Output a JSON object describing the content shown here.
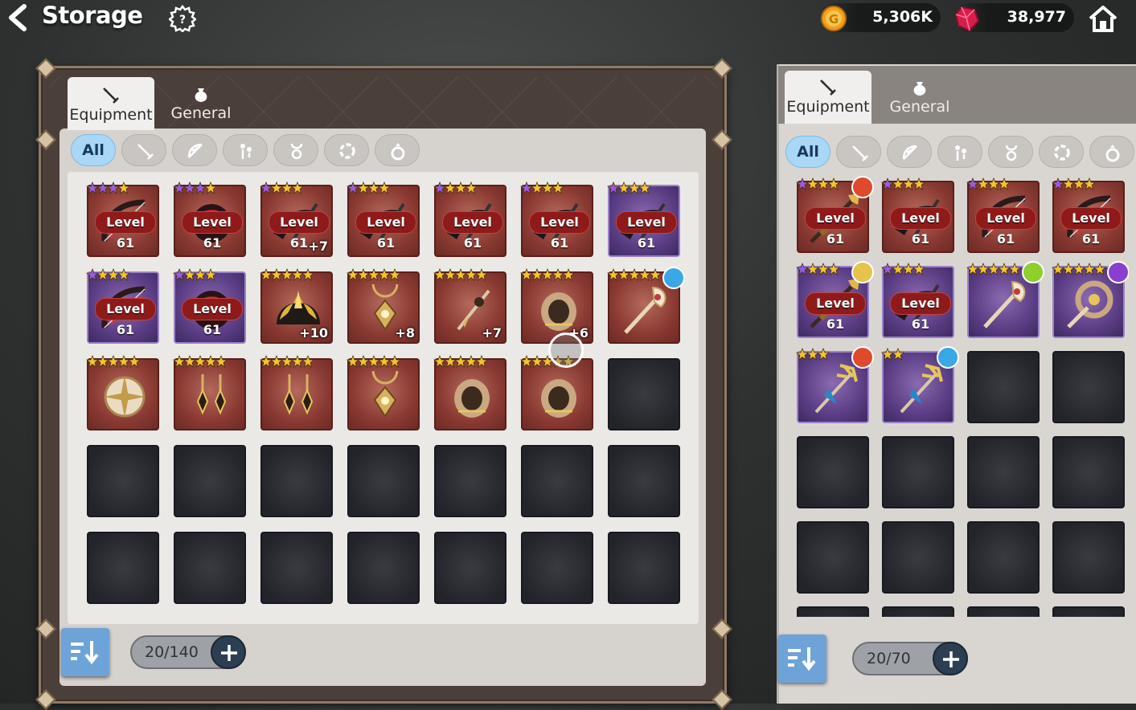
{
  "header": {
    "title": "Storage"
  },
  "currency": {
    "gold": "5,306K",
    "gems": "38,977"
  },
  "left": {
    "tabs": [
      {
        "label": "Equipment"
      },
      {
        "label": "General"
      }
    ],
    "filter_all": "All",
    "count": "20/140",
    "slots": [
      {
        "frame": "red",
        "art": "bow",
        "stars": 4,
        "starColor": "purple",
        "level": "Level 61"
      },
      {
        "frame": "red",
        "art": "orb",
        "stars": 4,
        "starColor": "purple",
        "level": "Level 61"
      },
      {
        "frame": "red",
        "art": "scythe",
        "stars": 4,
        "starColor": "mixed",
        "level": "Level 61",
        "plus": "+7"
      },
      {
        "frame": "red",
        "art": "scythe",
        "stars": 4,
        "starColor": "mixed",
        "level": "Level 61"
      },
      {
        "frame": "red",
        "art": "scythe",
        "stars": 4,
        "starColor": "mixed",
        "level": "Level 61"
      },
      {
        "frame": "red",
        "art": "scythe",
        "stars": 4,
        "starColor": "mixed",
        "level": "Level 61"
      },
      {
        "frame": "purple",
        "art": "scythe",
        "stars": 4,
        "starColor": "mixed",
        "level": "Level 61"
      },
      {
        "frame": "purple",
        "art": "bow",
        "stars": 4,
        "starColor": "mixed",
        "level": "Level 61"
      },
      {
        "frame": "purple",
        "art": "orb",
        "stars": 4,
        "starColor": "mixed",
        "level": "Level 61"
      },
      {
        "frame": "red",
        "art": "helm",
        "stars": 5,
        "starColor": "gold",
        "plus": "+10"
      },
      {
        "frame": "red",
        "art": "amulet",
        "stars": 5,
        "starColor": "gold",
        "plus": "+8"
      },
      {
        "frame": "red",
        "art": "earring",
        "stars": 5,
        "starColor": "gold",
        "plus": "+7"
      },
      {
        "frame": "red",
        "art": "bracer",
        "stars": 5,
        "starColor": "gold",
        "plus": "+6"
      },
      {
        "frame": "red",
        "art": "staff",
        "stars": 5,
        "starColor": "gold",
        "elem": "water"
      },
      {
        "frame": "red",
        "art": "compass",
        "stars": 5,
        "starColor": "gold"
      },
      {
        "frame": "red",
        "art": "earrings",
        "stars": 5,
        "starColor": "gold"
      },
      {
        "frame": "red",
        "art": "earrings",
        "stars": 5,
        "starColor": "gold"
      },
      {
        "frame": "red",
        "art": "amulet",
        "stars": 5,
        "starColor": "gold"
      },
      {
        "frame": "red",
        "art": "bracer",
        "stars": 5,
        "starColor": "gold"
      },
      {
        "frame": "red",
        "art": "bracer",
        "stars": 5,
        "starColor": "gold"
      },
      {
        "frame": "empty"
      },
      {
        "frame": "empty"
      },
      {
        "frame": "empty"
      },
      {
        "frame": "empty"
      },
      {
        "frame": "empty"
      },
      {
        "frame": "empty"
      },
      {
        "frame": "empty"
      },
      {
        "frame": "empty"
      },
      {
        "frame": "empty"
      },
      {
        "frame": "empty"
      },
      {
        "frame": "empty"
      },
      {
        "frame": "empty"
      },
      {
        "frame": "empty"
      },
      {
        "frame": "empty"
      },
      {
        "frame": "empty"
      }
    ]
  },
  "right": {
    "tabs": [
      {
        "label": "Equipment"
      },
      {
        "label": "General"
      }
    ],
    "filter_all": "All",
    "count": "20/70",
    "slots": [
      {
        "frame": "red",
        "art": "spear",
        "stars": 4,
        "starColor": "mixed",
        "level": "Level 61",
        "elem": "fire"
      },
      {
        "frame": "red",
        "art": "scythe",
        "stars": 4,
        "starColor": "mixed",
        "level": "Level 61"
      },
      {
        "frame": "red",
        "art": "bow",
        "stars": 4,
        "starColor": "mixed",
        "level": "Level 61"
      },
      {
        "frame": "red",
        "art": "bow",
        "stars": 4,
        "starColor": "mixed",
        "level": "Level 61"
      },
      {
        "frame": "purple",
        "art": "spear",
        "stars": 4,
        "starColor": "mixed",
        "level": "Level 61",
        "elem": "light"
      },
      {
        "frame": "purple",
        "art": "scythe",
        "stars": 4,
        "starColor": "mixed",
        "level": "Level 61"
      },
      {
        "frame": "purple",
        "art": "staff",
        "stars": 5,
        "starColor": "gold",
        "elem": "earth"
      },
      {
        "frame": "purple",
        "art": "wheel",
        "stars": 5,
        "starColor": "gold",
        "elem": "dark"
      },
      {
        "frame": "purple",
        "art": "trident",
        "stars": 3,
        "starColor": "gold",
        "elem": "fire"
      },
      {
        "frame": "purple",
        "art": "trident",
        "stars": 2,
        "starColor": "gold",
        "elem": "water"
      },
      {
        "frame": "empty"
      },
      {
        "frame": "empty"
      },
      {
        "frame": "empty"
      },
      {
        "frame": "empty"
      },
      {
        "frame": "empty"
      },
      {
        "frame": "empty"
      },
      {
        "frame": "empty"
      },
      {
        "frame": "empty"
      },
      {
        "frame": "empty"
      },
      {
        "frame": "empty"
      },
      {
        "frame": "empty"
      },
      {
        "frame": "empty"
      },
      {
        "frame": "empty"
      },
      {
        "frame": "empty"
      }
    ]
  },
  "icons": {
    "back": "chevron-left-icon",
    "help": "gear-question-icon",
    "home": "home-icon",
    "gold": "gold-coin-icon",
    "gem": "red-gem-icon",
    "filters": [
      "weapon-icon",
      "bow-icon",
      "earring-icon",
      "amulet-icon",
      "bracelet-icon",
      "ring-icon"
    ]
  },
  "colors": {
    "accent_blue": "#6ea3d8",
    "level_badge": "#8e1a1a",
    "filter_active": "#a9d7f5"
  }
}
